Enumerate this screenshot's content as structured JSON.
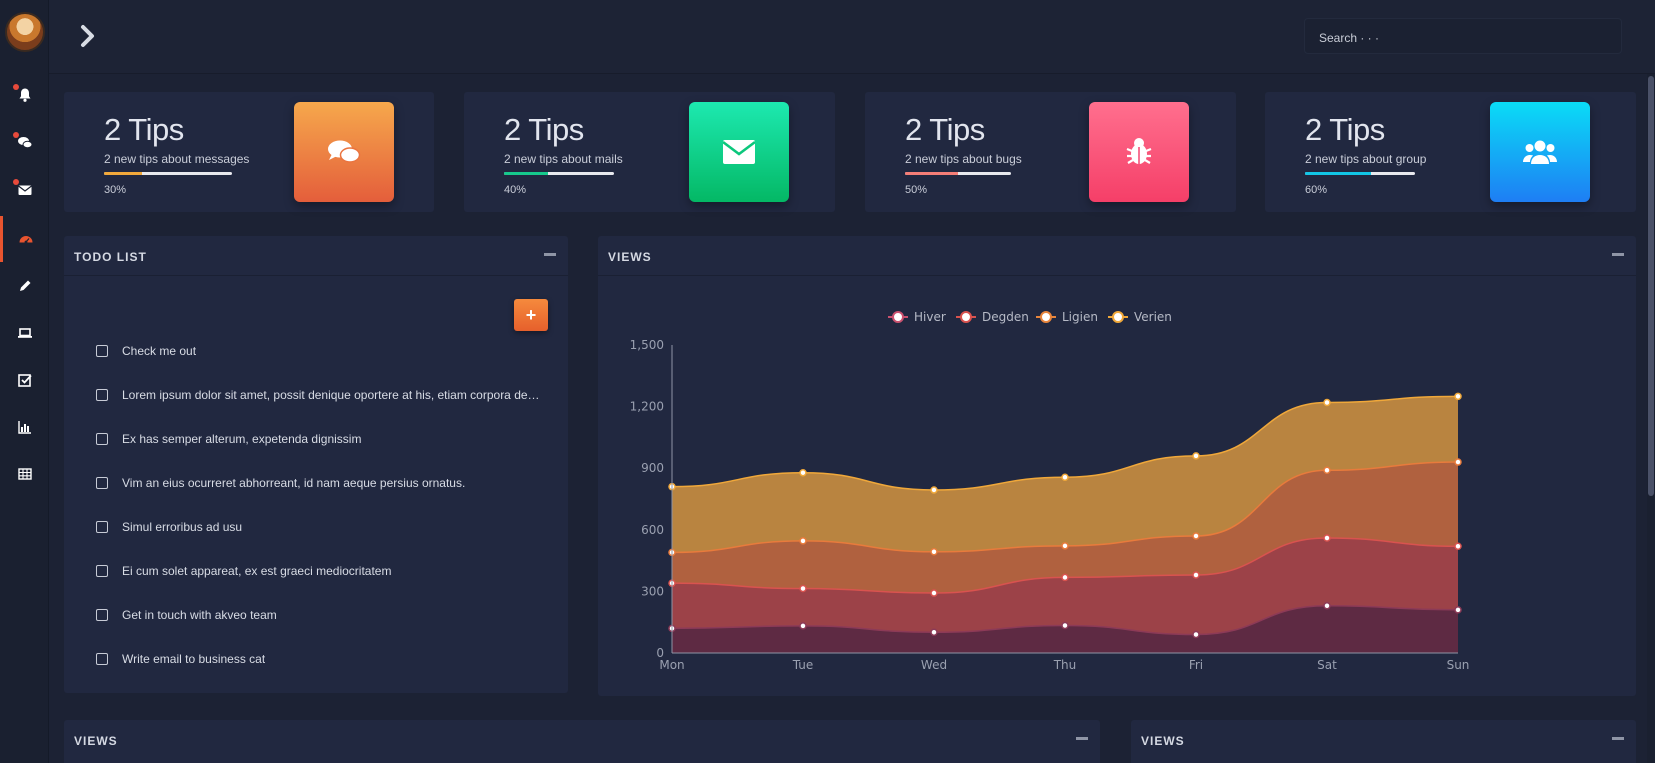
{
  "topbar": {
    "search_placeholder": "Search · · ·"
  },
  "sidebar": {
    "items": [
      {
        "icon": "bell-icon",
        "badge": true
      },
      {
        "icon": "comments-icon",
        "badge": true
      },
      {
        "icon": "envelope-icon",
        "badge": true
      },
      {
        "icon": "dashboard-icon",
        "active": true
      },
      {
        "icon": "pencil-icon"
      },
      {
        "icon": "laptop-icon"
      },
      {
        "icon": "checkbox-icon"
      },
      {
        "icon": "bar-chart-icon"
      },
      {
        "icon": "table-icon"
      }
    ]
  },
  "cards": [
    {
      "title": "2 Tips",
      "subtitle": "2 new tips about messages",
      "percent": "30%",
      "progress": 0.3,
      "icon": "comments-icon",
      "colors": [
        "#f2a24a",
        "#e4603a"
      ]
    },
    {
      "title": "2 Tips",
      "subtitle": "2 new tips about mails",
      "percent": "40%",
      "progress": 0.4,
      "icon": "envelope-icon",
      "colors": [
        "#19e3a6",
        "#05b864"
      ]
    },
    {
      "title": "2 Tips",
      "subtitle": "2 new tips about bugs",
      "percent": "50%",
      "progress": 0.5,
      "icon": "bug-icon",
      "colors": [
        "#ff6f8c",
        "#f6406a"
      ]
    },
    {
      "title": "2 Tips",
      "subtitle": "2 new tips about group",
      "percent": "60%",
      "progress": 0.6,
      "icon": "users-icon",
      "colors": [
        "#09d8f5",
        "#1e7ef5"
      ]
    }
  ],
  "todo": {
    "title": "TODO LIST",
    "add_label": "+",
    "items": [
      "Check me out",
      "Lorem ipsum dolor sit amet, possit denique oportere at his, etiam corpora deseruisse te...",
      "Ex has semper alterum, expetenda dignissim",
      "Vim an eius ocurreret abhorreant, id nam aeque persius ornatus.",
      "Simul erroribus ad usu",
      "Ei cum solet appareat, ex est graeci mediocritatem",
      "Get in touch with akveo team",
      "Write email to business cat"
    ]
  },
  "views_panel": {
    "title": "VIEWS"
  },
  "bottom_panels": [
    {
      "title": "VIEWS"
    },
    {
      "title": "VIEWS"
    }
  ],
  "chart_data": {
    "type": "area",
    "stacked": true,
    "categories": [
      "Mon",
      "Tue",
      "Wed",
      "Thu",
      "Fri",
      "Sat",
      "Sun"
    ],
    "ylim": [
      0,
      1500
    ],
    "yticks": [
      "0",
      "300",
      "600",
      "900",
      "1,200",
      "1,500"
    ],
    "legend_position": "top-center",
    "series": [
      {
        "name": "Hiver",
        "values": [
          120,
          132,
          101,
          134,
          90,
          230,
          210
        ],
        "color": "#5e2a43"
      },
      {
        "name": "Degden",
        "values": [
          220,
          182,
          191,
          234,
          290,
          330,
          310
        ],
        "color": "#9c4248"
      },
      {
        "name": "Ligien",
        "values": [
          150,
          232,
          201,
          154,
          190,
          330,
          410
        ],
        "color": "#b0613f"
      },
      {
        "name": "Verien",
        "values": [
          320,
          332,
          301,
          334,
          390,
          330,
          320
        ],
        "color": "#b98440"
      }
    ]
  }
}
